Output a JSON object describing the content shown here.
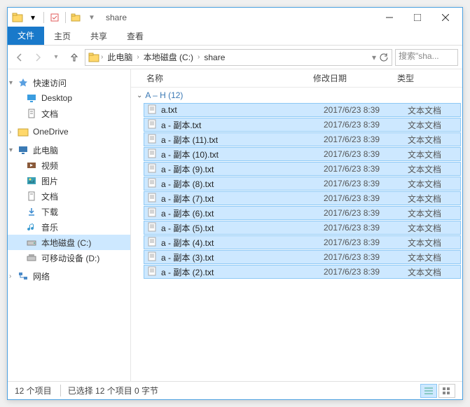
{
  "title": "share",
  "tabs": {
    "file": "文件",
    "home": "主页",
    "share": "共享",
    "view": "查看"
  },
  "breadcrumb": {
    "pc": "此电脑",
    "drive": "本地磁盘 (C:)",
    "folder": "share"
  },
  "search": {
    "placeholder": "搜索\"sha..."
  },
  "columns": {
    "name": "名称",
    "date": "修改日期",
    "type": "类型"
  },
  "sidebar": {
    "quick": "快速访问",
    "desktop": "Desktop",
    "docs1": "文档",
    "onedrive": "OneDrive",
    "pc": "此电脑",
    "video": "视频",
    "pictures": "图片",
    "docs2": "文档",
    "downloads": "下载",
    "music": "音乐",
    "drivec": "本地磁盘 (C:)",
    "drived": "可移动设备 (D:)",
    "network": "网络"
  },
  "group": {
    "label": "A – H (12)"
  },
  "files": [
    {
      "name": "a.txt",
      "date": "2017/6/23 8:39",
      "type": "文本文档"
    },
    {
      "name": "a - 副本.txt",
      "date": "2017/6/23 8:39",
      "type": "文本文档"
    },
    {
      "name": "a - 副本 (11).txt",
      "date": "2017/6/23 8:39",
      "type": "文本文档"
    },
    {
      "name": "a - 副本 (10).txt",
      "date": "2017/6/23 8:39",
      "type": "文本文档"
    },
    {
      "name": "a - 副本 (9).txt",
      "date": "2017/6/23 8:39",
      "type": "文本文档"
    },
    {
      "name": "a - 副本 (8).txt",
      "date": "2017/6/23 8:39",
      "type": "文本文档"
    },
    {
      "name": "a - 副本 (7).txt",
      "date": "2017/6/23 8:39",
      "type": "文本文档"
    },
    {
      "name": "a - 副本 (6).txt",
      "date": "2017/6/23 8:39",
      "type": "文本文档"
    },
    {
      "name": "a - 副本 (5).txt",
      "date": "2017/6/23 8:39",
      "type": "文本文档"
    },
    {
      "name": "a - 副本 (4).txt",
      "date": "2017/6/23 8:39",
      "type": "文本文档"
    },
    {
      "name": "a - 副本 (3).txt",
      "date": "2017/6/23 8:39",
      "type": "文本文档"
    },
    {
      "name": "a - 副本 (2).txt",
      "date": "2017/6/23 8:39",
      "type": "文本文档"
    }
  ],
  "status": {
    "count": "12 个项目",
    "selected": "已选择 12 个项目 0 字节"
  }
}
